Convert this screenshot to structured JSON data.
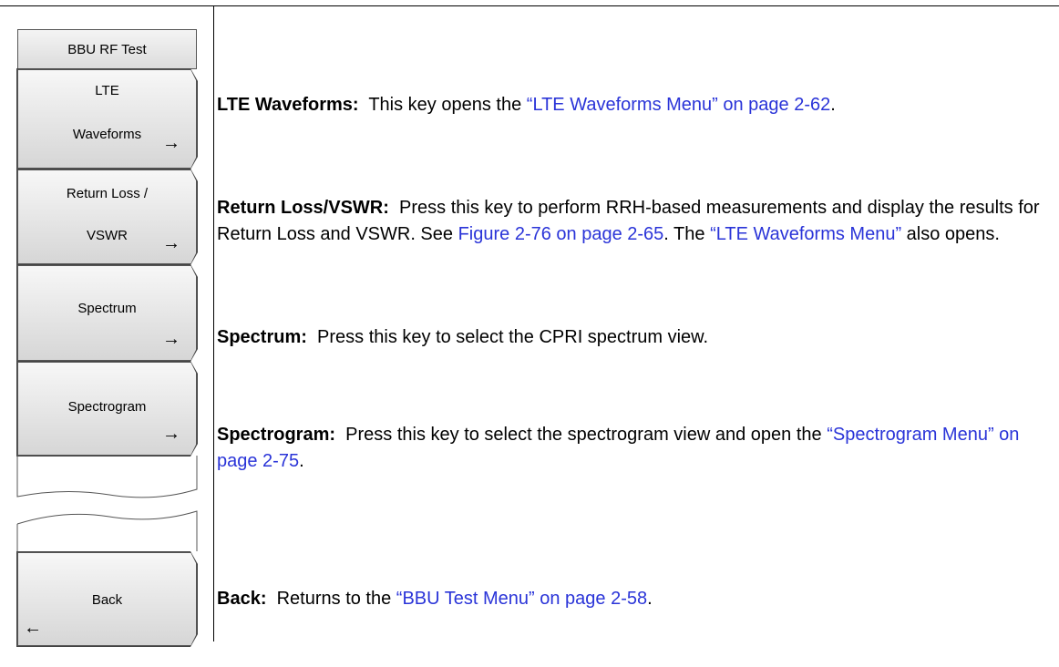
{
  "menu": {
    "title": "BBU RF Test",
    "buttons": [
      {
        "line1": "LTE",
        "line2": "Waveforms",
        "arrow": "→"
      },
      {
        "line1": "Return Loss /",
        "line2": "VSWR",
        "arrow": "→"
      },
      {
        "line1": "Spectrum",
        "arrow": "→"
      },
      {
        "line1": "Spectrogram",
        "arrow": "→"
      },
      {
        "line1": "Back",
        "arrow": "←"
      }
    ]
  },
  "descriptions": {
    "lte": {
      "term": "LTE Waveforms:",
      "text1": "This key opens the ",
      "link1": "“LTE Waveforms Menu” on page 2-62",
      "text2": "."
    },
    "rl": {
      "term": "Return Loss/VSWR:",
      "text1": "Press this key to perform RRH-based measurements and display the results for Return Loss and VSWR. See ",
      "link1": "Figure 2-76 on page 2-65",
      "text2": ". The ",
      "link2": "“LTE Waveforms Menu”",
      "text3": " also opens."
    },
    "spectrum": {
      "term": "Spectrum:",
      "text1": "Press this key to select the CPRI spectrum view."
    },
    "spectrogram": {
      "term": "Spectrogram:",
      "text1": "Press this key to select the spectrogram view and open the ",
      "link1": "“Spectrogram Menu” on page 2-75",
      "text2": "."
    },
    "back": {
      "term": "Back:",
      "text1": "Returns to the ",
      "link1": "“BBU Test Menu” on page 2-58",
      "text2": "."
    }
  },
  "colors": {
    "link": "#2a34d8",
    "key_face": "#e4e4e4",
    "key_border": "#444444"
  }
}
